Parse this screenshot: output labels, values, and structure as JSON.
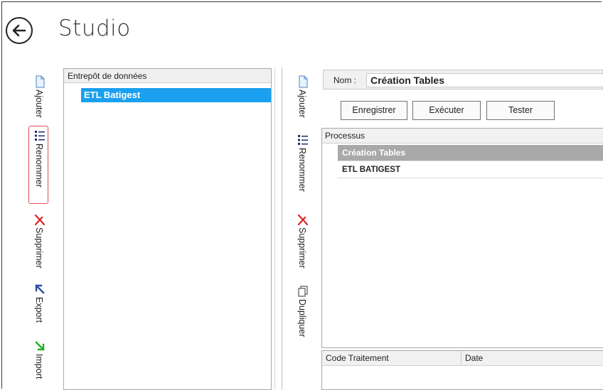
{
  "app": {
    "title": "Studio"
  },
  "left_toolbar": {
    "items": [
      {
        "label": "Ajouter",
        "icon": "document-icon"
      },
      {
        "label": "Renommer",
        "icon": "list-icon"
      },
      {
        "label": "Supprimer",
        "icon": "red-x-icon"
      },
      {
        "label": "Export",
        "icon": "export-arrow-icon"
      },
      {
        "label": "Import",
        "icon": "import-arrow-icon"
      }
    ]
  },
  "warehouse_panel": {
    "header": "Entrepôt de données",
    "items": [
      {
        "label": "ETL Batigest",
        "selected": true
      }
    ]
  },
  "right_toolbar": {
    "items": [
      {
        "label": "Ajouter",
        "icon": "document-icon"
      },
      {
        "label": "Renommer",
        "icon": "list-icon"
      },
      {
        "label": "Supprimer",
        "icon": "red-x-icon"
      },
      {
        "label": "Dupliquer",
        "icon": "duplicate-icon"
      }
    ]
  },
  "detail": {
    "name_label": "Nom :",
    "name_value": "Création Tables",
    "buttons": {
      "save": "Enregistrer",
      "run": "Exécuter",
      "test": "Tester"
    },
    "process_grid": {
      "header": "Processus",
      "rows": [
        {
          "label": "Création Tables",
          "selected": true
        },
        {
          "label": "ETL BATIGEST",
          "selected": false
        }
      ]
    },
    "treatment_grid": {
      "columns": [
        "Code Traitement",
        "Date"
      ]
    }
  },
  "colors": {
    "selection_blue": "#1aa0ee",
    "selection_gray": "#a9a9a9",
    "highlight_red": "#e05050"
  }
}
